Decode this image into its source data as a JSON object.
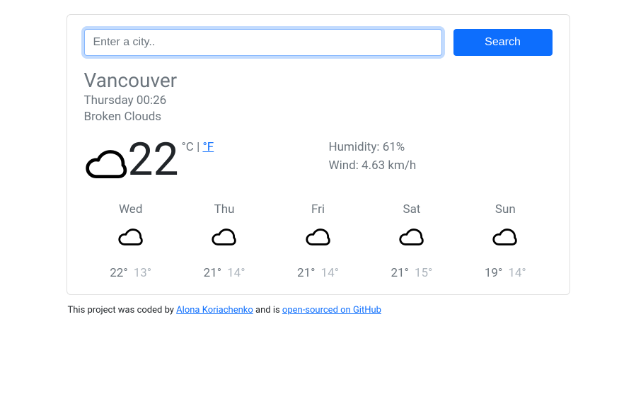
{
  "search": {
    "placeholder": "Enter a city..",
    "button_label": "Search"
  },
  "current": {
    "city": "Vancouver",
    "datetime": "Thursday 00:26",
    "description": "Broken Clouds",
    "temperature": "22",
    "unit_c": "°C",
    "unit_sep": " | ",
    "unit_f": "°F",
    "humidity_label": "Humidity: ",
    "humidity_value": "61%",
    "wind_label": "Wind: ",
    "wind_value": "4.63 km/h"
  },
  "forecast": [
    {
      "day": "Wed",
      "high": "22°",
      "low": "13°"
    },
    {
      "day": "Thu",
      "high": "21°",
      "low": "14°"
    },
    {
      "day": "Fri",
      "high": "21°",
      "low": "14°"
    },
    {
      "day": "Sat",
      "high": "21°",
      "low": "15°"
    },
    {
      "day": "Sun",
      "high": "19°",
      "low": "14°"
    }
  ],
  "footer": {
    "prefix": "This project was coded by ",
    "author": "Alona Koriachenko",
    "mid": " and is ",
    "link_text": "open-sourced on GitHub"
  },
  "icons": {
    "cloud": "cloud-icon"
  }
}
